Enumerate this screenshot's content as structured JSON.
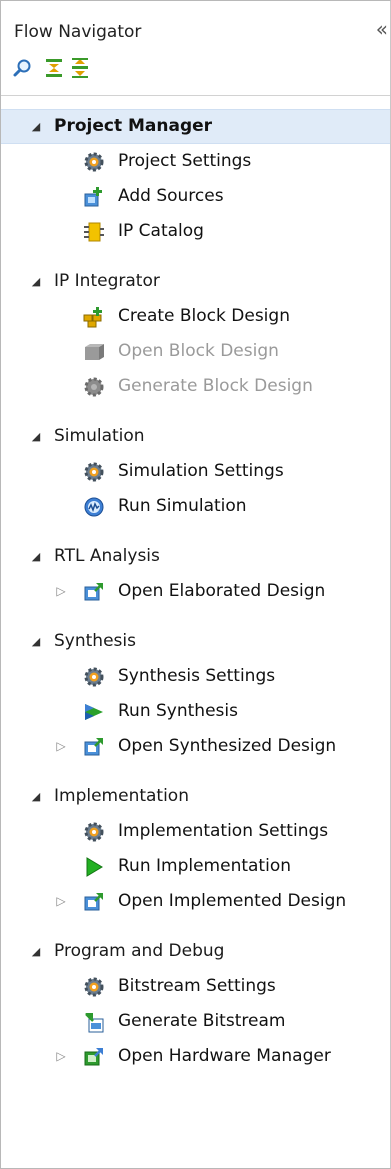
{
  "panel": {
    "title": "Flow Navigator",
    "collapse_glyph": "«"
  },
  "toolbar": {
    "icons": [
      "search-icon",
      "collapse-all-icon",
      "expand-all-icon"
    ]
  },
  "sections": [
    {
      "title": "Project Manager",
      "items": [
        {
          "label": "Project Settings",
          "icon": "gear-icon"
        },
        {
          "label": "Add Sources",
          "icon": "add-sources-icon"
        },
        {
          "label": "IP Catalog",
          "icon": "ip-catalog-icon"
        }
      ]
    },
    {
      "title": "IP Integrator",
      "items": [
        {
          "label": "Create Block Design",
          "icon": "create-block-icon"
        },
        {
          "label": "Open Block Design",
          "icon": "open-block-icon"
        },
        {
          "label": "Generate Block Design",
          "icon": "generate-block-icon"
        }
      ]
    },
    {
      "title": "Simulation",
      "items": [
        {
          "label": "Simulation Settings",
          "icon": "gear-icon"
        },
        {
          "label": "Run Simulation",
          "icon": "run-simulation-icon"
        }
      ]
    },
    {
      "title": "RTL Analysis",
      "items": [
        {
          "label": "Open Elaborated Design",
          "icon": "open-design-icon"
        }
      ]
    },
    {
      "title": "Synthesis",
      "items": [
        {
          "label": "Synthesis Settings",
          "icon": "gear-icon"
        },
        {
          "label": "Run Synthesis",
          "icon": "run-synthesis-icon"
        },
        {
          "label": "Open Synthesized Design",
          "icon": "open-design-icon"
        }
      ]
    },
    {
      "title": "Implementation",
      "items": [
        {
          "label": "Implementation Settings",
          "icon": "gear-icon"
        },
        {
          "label": "Run Implementation",
          "icon": "play-icon"
        },
        {
          "label": "Open Implemented Design",
          "icon": "open-design-icon"
        }
      ]
    },
    {
      "title": "Program and Debug",
      "items": [
        {
          "label": "Bitstream Settings",
          "icon": "gear-icon"
        },
        {
          "label": "Generate Bitstream",
          "icon": "generate-bitstream-icon"
        },
        {
          "label": "Open Hardware Manager",
          "icon": "open-hardware-icon"
        }
      ]
    }
  ]
}
